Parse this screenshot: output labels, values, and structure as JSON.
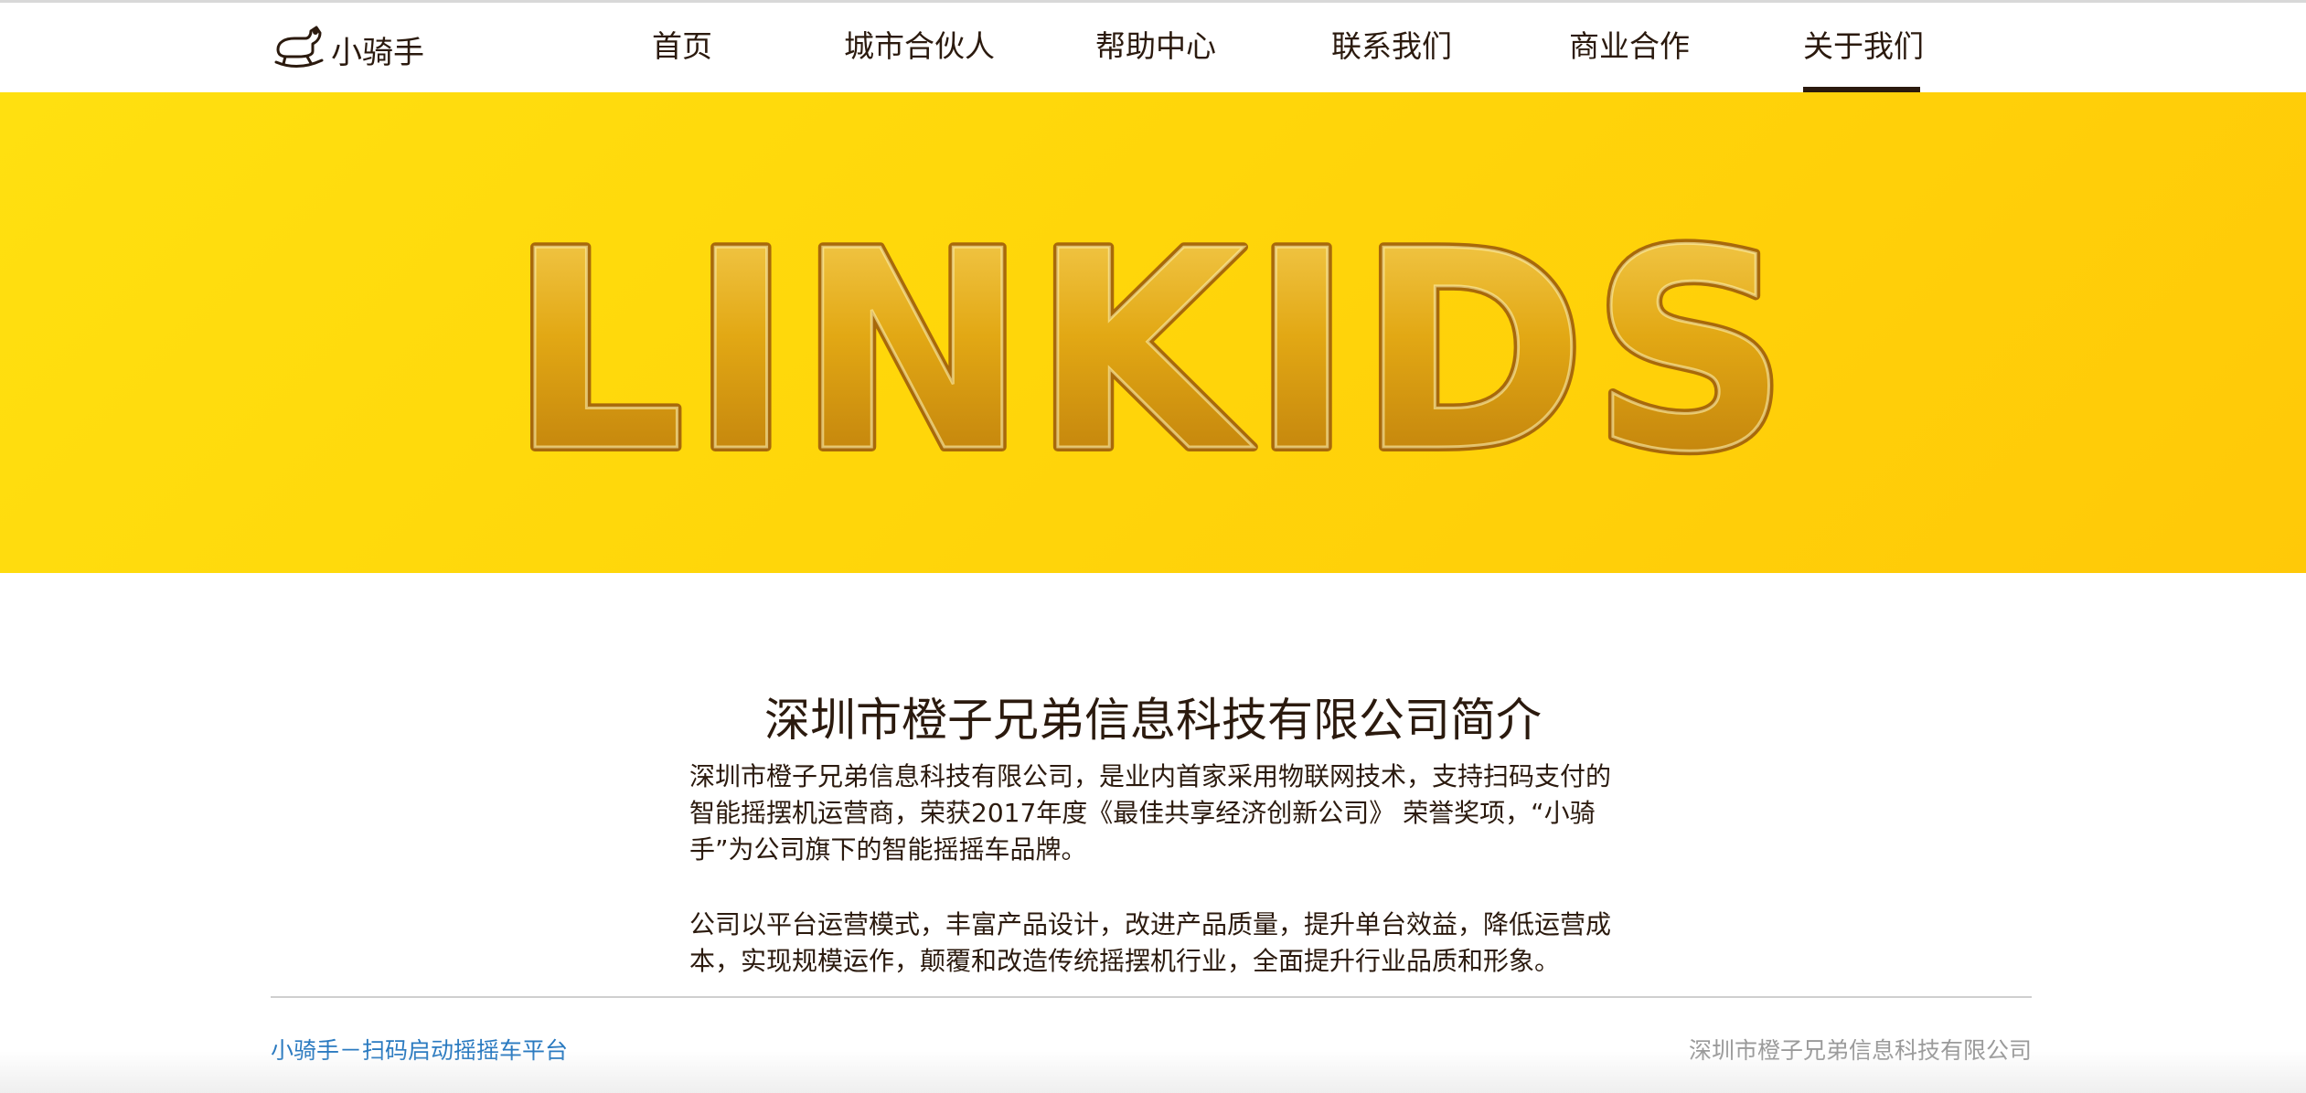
{
  "nav": {
    "logo_text": "小骑手",
    "items": [
      {
        "label": "首页"
      },
      {
        "label": "城市合伙人"
      },
      {
        "label": "帮助中心"
      },
      {
        "label": "联系我们"
      },
      {
        "label": "商业合作"
      },
      {
        "label": "关于我们",
        "active": true
      }
    ]
  },
  "banner": {
    "text": "LINKIDS",
    "bg_color": "#ffd60a",
    "balloon_color": "#e0a010"
  },
  "about": {
    "title": "深圳市橙子兄弟信息科技有限公司简介",
    "paragraph1_lines": [
      "深圳市橙子兄弟信息科技有限公司，是业内首家采用物联网技术，支持扫码支付的",
      "智能摇摆机运营商，荣获2017年度《最佳共享经济创新公司》 荣誉奖项，“小骑",
      "手”为公司旗下的智能摇摇车品牌。"
    ],
    "paragraph2_lines": [
      "公司以平台运营模式，丰富产品设计，改进产品质量，提升单台效益，降低运营成",
      "本，实现规模运作，颠覆和改造传统摇摆机行业，全面提升行业品质和形象。"
    ]
  },
  "footer": {
    "left_link": "小骑手－扫码启动摇摇车平台",
    "right_text": "深圳市橙子兄弟信息科技有限公司"
  }
}
